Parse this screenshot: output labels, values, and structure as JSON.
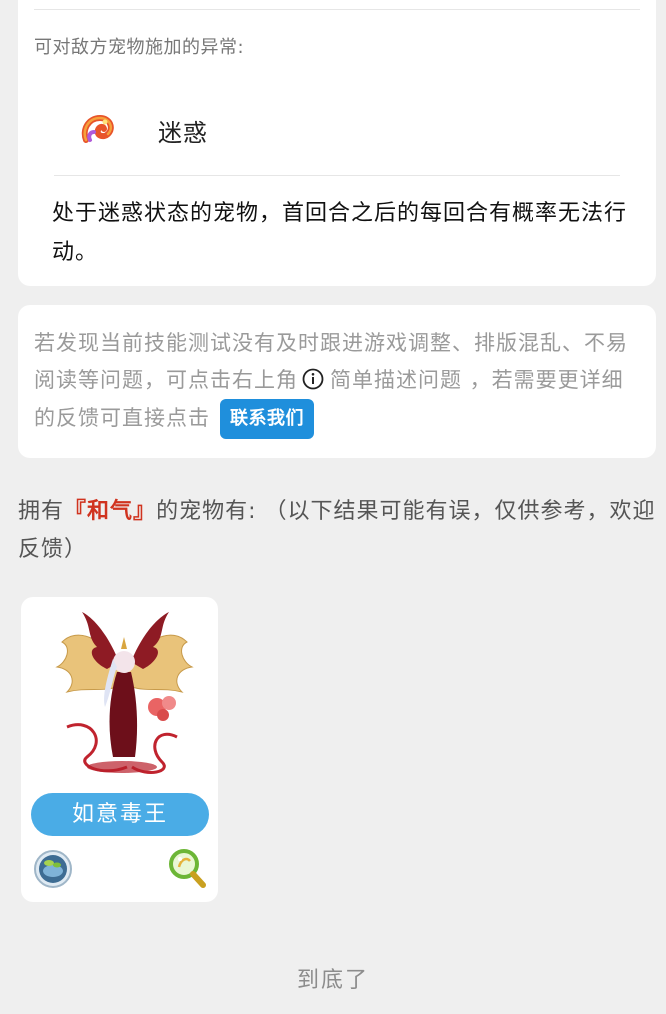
{
  "status_section": {
    "label": "可对敌方宠物施加的异常:",
    "status_name": "迷惑",
    "status_icon": "confusion-swirl-icon",
    "status_description": "处于迷惑状态的宠物，首回合之后的每回合有概率无法行动。"
  },
  "feedback": {
    "text_before_icon": "若发现当前技能测试没有及时跟进游戏调整、排版混乱、不易阅读等问题，可点击右上角",
    "icon": "info-circle-icon",
    "text_after_icon": "简单描述问题 ，若需要更详细的反馈可直接点击",
    "contact_button_label": "联系我们"
  },
  "owners": {
    "prefix": "拥有",
    "open_bracket": "『",
    "trait_name": "和气",
    "close_bracket": "』",
    "suffix": "的宠物有: （以下结果可能有误，仅供参考，欢迎反馈）"
  },
  "pets": [
    {
      "name": "如意毒王",
      "image": "winged-demon-pet-illustration",
      "attribute_icon": "poison-attribute-icon",
      "detail_icon": "magnifier-icon"
    }
  ],
  "footer": {
    "end_text": "到底了"
  },
  "colors": {
    "accent_blue": "#1f8fdc",
    "pet_button_blue": "#4aace6",
    "trait_red": "#d0331f",
    "background": "#efefef"
  }
}
